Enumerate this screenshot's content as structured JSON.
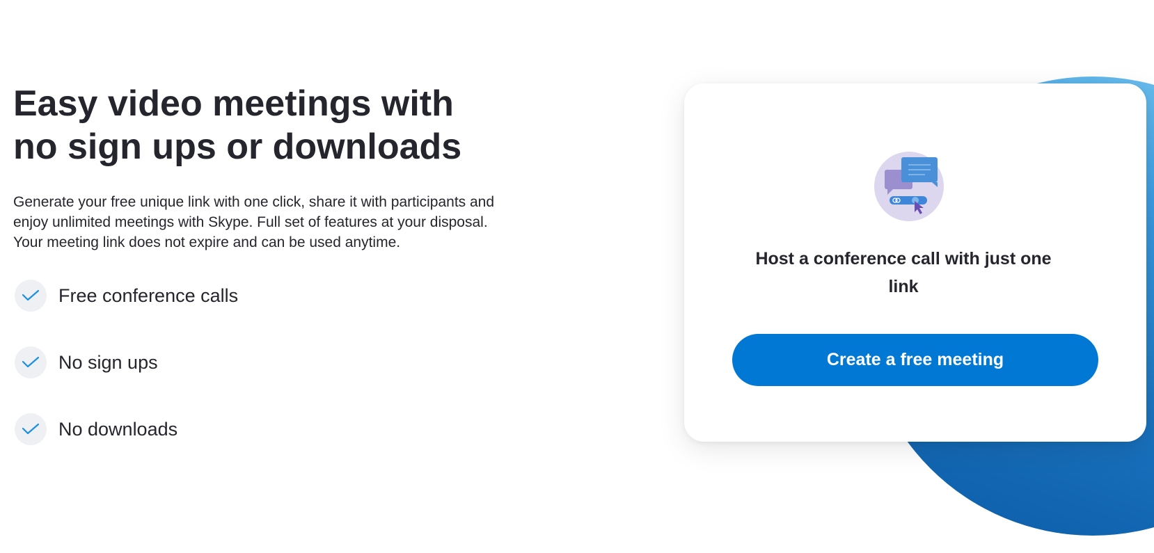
{
  "hero": {
    "headline": "Easy video meetings with no sign ups or downloads",
    "intro": "Generate your free unique link with one click, share it with participants and enjoy unlimited meetings with Skype. Full set of features at your disposal. Your meeting link does not expire and can be used anytime.",
    "features": [
      {
        "label": "Free conference calls",
        "icon": "check-icon"
      },
      {
        "label": "No sign ups",
        "icon": "check-icon"
      },
      {
        "label": "No downloads",
        "icon": "check-icon"
      }
    ]
  },
  "card": {
    "illustration_icon": "chat-link-illustration",
    "title": "Host a conference call with just one link",
    "button_label": "Create a free meeting"
  },
  "colors": {
    "accent": "#0078d4",
    "check": "#1a8fe3",
    "text": "#25252d",
    "check_bg": "#eef0f4"
  }
}
